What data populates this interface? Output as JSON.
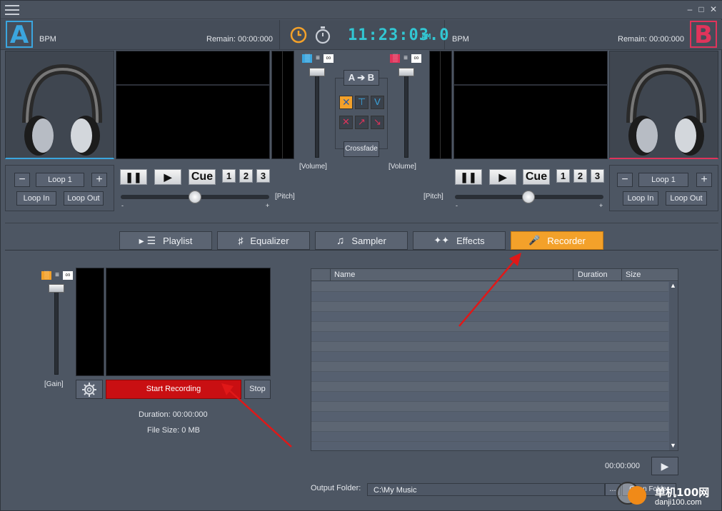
{
  "deckA": {
    "letter": "A",
    "bpm_label": "BPM",
    "remain": "Remain: 00:00:000",
    "color": "#3ba6df",
    "loop_label": "Loop 1",
    "loop_in": "Loop In",
    "loop_out": "Loop Out",
    "minus": "−",
    "plus": "+"
  },
  "deckB": {
    "letter": "B",
    "bpm_label": "BPM",
    "remain": "Remain: 00:00:000",
    "color": "#e0345b",
    "loop_label": "Loop 1",
    "loop_in": "Loop In",
    "loop_out": "Loop Out",
    "minus": "−",
    "plus": "+"
  },
  "clock": {
    "time": "11:23:03.0",
    "ampm": "AM",
    "color": "#32c7d3"
  },
  "transport": {
    "cue": "Cue",
    "hot1": "1",
    "hot2": "2",
    "hot3": "3",
    "pitch": "[Pitch]",
    "minus": "-",
    "plus": "+"
  },
  "mixer": {
    "volume": "[Volume]",
    "ab": "A ➔ B",
    "crossfade": "Crossfade"
  },
  "tabs": [
    {
      "label": "Playlist",
      "icon": "list-icon"
    },
    {
      "label": "Equalizer",
      "icon": "equalizer-icon"
    },
    {
      "label": "Sampler",
      "icon": "music-note-icon"
    },
    {
      "label": "Effects",
      "icon": "sparkle-icon"
    },
    {
      "label": "Recorder",
      "icon": "microphone-icon",
      "active": true
    }
  ],
  "recorder": {
    "gain": "[Gain]",
    "start": "Start Recording",
    "stop": "Stop",
    "duration": "Duration: 00:00:000",
    "filesize": "File Size: 0 MB",
    "columns": [
      "Name",
      "Duration",
      "Size"
    ],
    "time": "00:00:000",
    "output_label": "Output Folder:",
    "output_value": "C:\\My Music",
    "open_folder": "Open Folder",
    "browse": "...",
    "start_color": "#c90f12"
  },
  "watermark": {
    "line1": "单机100网",
    "line2": "danji100.com"
  }
}
